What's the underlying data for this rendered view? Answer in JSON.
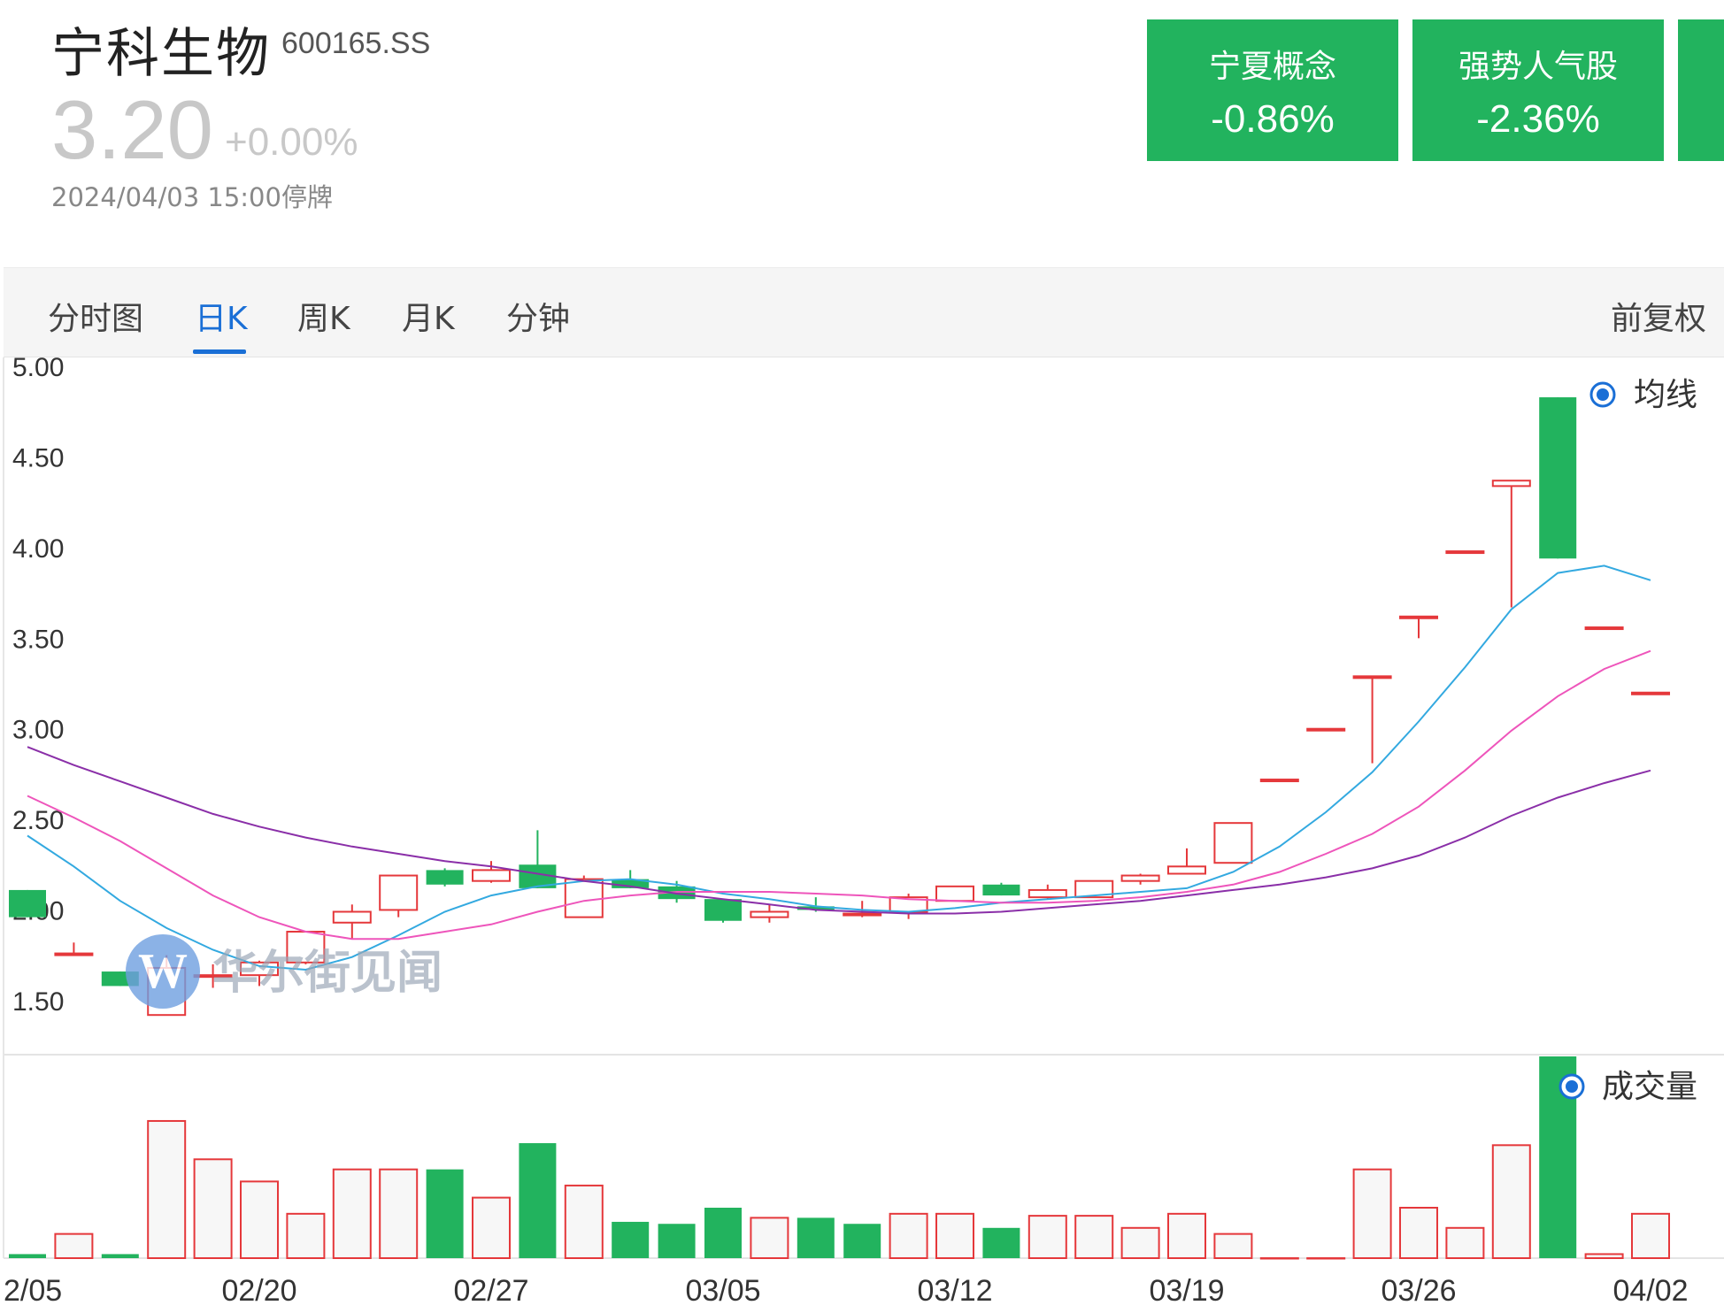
{
  "header": {
    "name": "宁科生物",
    "code": "600165.SS",
    "price": "3.20",
    "change": "+0.00%",
    "status": "2024/04/03 15:00停牌"
  },
  "tags": [
    {
      "name": "宁夏概念",
      "change": "-0.86%"
    },
    {
      "name": "强势人气股",
      "change": "-2.36%"
    }
  ],
  "tabs": [
    "分时图",
    "日K",
    "周K",
    "月K",
    "分钟"
  ],
  "active_tab": "日K",
  "adjust_label": "前复权",
  "watermark": "华尔街见闻",
  "colors": {
    "up": "#e5383b",
    "down": "#22b35e",
    "accent": "#1a6fd6",
    "ma5": "#33a9e0",
    "ma10": "#ee55bb",
    "ma20": "#8a2fa8"
  },
  "chart_data": [
    {
      "type": "candlestick",
      "title": "",
      "legend": "均线",
      "yticks": [
        "5.00",
        "4.50",
        "4.00",
        "3.50",
        "3.00",
        "2.50",
        "2.00",
        "1.50"
      ],
      "ylim": [
        1.25,
        5.05
      ],
      "xticks": [
        {
          "label": "2/05",
          "index": 0
        },
        {
          "label": "02/20",
          "index": 5
        },
        {
          "label": "02/27",
          "index": 10
        },
        {
          "label": "03/05",
          "index": 15
        },
        {
          "label": "03/12",
          "index": 20
        },
        {
          "label": "03/19",
          "index": 25
        },
        {
          "label": "03/26",
          "index": 30
        },
        {
          "label": "04/02",
          "index": 35
        }
      ],
      "candles": [
        {
          "o": 2.11,
          "c": 1.96,
          "h": 2.11,
          "l": 1.96
        },
        {
          "o": 1.76,
          "c": 1.76,
          "h": 1.82,
          "l": 1.76
        },
        {
          "o": 1.66,
          "c": 1.58,
          "h": 1.66,
          "l": 1.58
        },
        {
          "o": 1.42,
          "c": 1.68,
          "h": 1.75,
          "l": 1.42
        },
        {
          "o": 1.64,
          "c": 1.64,
          "h": 1.7,
          "l": 1.57
        },
        {
          "o": 1.64,
          "c": 1.71,
          "h": 1.72,
          "l": 1.58
        },
        {
          "o": 1.71,
          "c": 1.88,
          "h": 1.88,
          "l": 1.7
        },
        {
          "o": 1.93,
          "c": 1.99,
          "h": 2.03,
          "l": 1.84
        },
        {
          "o": 2.0,
          "c": 2.19,
          "h": 2.19,
          "l": 1.96
        },
        {
          "o": 2.22,
          "c": 2.14,
          "h": 2.23,
          "l": 2.13
        },
        {
          "o": 2.16,
          "c": 2.22,
          "h": 2.27,
          "l": 2.15
        },
        {
          "o": 2.25,
          "c": 2.12,
          "h": 2.44,
          "l": 2.12
        },
        {
          "o": 1.96,
          "c": 2.17,
          "h": 2.19,
          "l": 1.96
        },
        {
          "o": 2.17,
          "c": 2.12,
          "h": 2.22,
          "l": 2.12
        },
        {
          "o": 2.13,
          "c": 2.06,
          "h": 2.16,
          "l": 2.04
        },
        {
          "o": 2.06,
          "c": 1.94,
          "h": 2.06,
          "l": 1.93
        },
        {
          "o": 1.96,
          "c": 1.99,
          "h": 2.03,
          "l": 1.93
        },
        {
          "o": 2.02,
          "c": 2.0,
          "h": 2.07,
          "l": 1.99
        },
        {
          "o": 1.98,
          "c": 1.98,
          "h": 2.05,
          "l": 1.96
        },
        {
          "o": 1.99,
          "c": 2.07,
          "h": 2.09,
          "l": 1.95
        },
        {
          "o": 2.05,
          "c": 2.13,
          "h": 2.13,
          "l": 2.05
        },
        {
          "o": 2.14,
          "c": 2.08,
          "h": 2.15,
          "l": 2.08
        },
        {
          "o": 2.07,
          "c": 2.11,
          "h": 2.14,
          "l": 2.06
        },
        {
          "o": 2.07,
          "c": 2.16,
          "h": 2.16,
          "l": 2.07
        },
        {
          "o": 2.16,
          "c": 2.19,
          "h": 2.2,
          "l": 2.14
        },
        {
          "o": 2.2,
          "c": 2.24,
          "h": 2.34,
          "l": 2.2
        },
        {
          "o": 2.26,
          "c": 2.48,
          "h": 2.48,
          "l": 2.26
        },
        {
          "o": 2.72,
          "c": 2.72,
          "h": 2.72,
          "l": 2.72
        },
        {
          "o": 3.0,
          "c": 3.0,
          "h": 3.0,
          "l": 3.0
        },
        {
          "o": 3.29,
          "c": 3.29,
          "h": 3.29,
          "l": 2.81
        },
        {
          "o": 3.62,
          "c": 3.62,
          "h": 3.62,
          "l": 3.5
        },
        {
          "o": 3.98,
          "c": 3.98,
          "h": 3.98,
          "l": 3.98
        },
        {
          "o": 4.34,
          "c": 4.37,
          "h": 4.37,
          "l": 3.67
        },
        {
          "o": 4.83,
          "c": 3.94,
          "h": 4.83,
          "l": 3.94
        },
        {
          "o": 3.56,
          "c": 3.56,
          "h": 3.56,
          "l": 3.56
        },
        {
          "o": 3.2,
          "c": 3.2,
          "h": 3.2,
          "l": 3.2
        }
      ],
      "ma_series": [
        {
          "values": [
            2.41,
            2.24,
            2.05,
            1.9,
            1.78,
            1.69,
            1.67,
            1.74,
            1.86,
            1.99,
            2.08,
            2.13,
            2.16,
            2.17,
            2.14,
            2.09,
            2.06,
            2.02,
            2.0,
            1.99,
            2.01,
            2.04,
            2.06,
            2.08,
            2.1,
            2.12,
            2.21,
            2.35,
            2.54,
            2.76,
            3.04,
            3.34,
            3.66,
            3.86,
            3.9,
            3.82
          ]
        },
        {
          "values": [
            2.63,
            2.51,
            2.38,
            2.23,
            2.08,
            1.96,
            1.88,
            1.84,
            1.84,
            1.88,
            1.92,
            1.99,
            2.05,
            2.08,
            2.1,
            2.1,
            2.1,
            2.09,
            2.08,
            2.06,
            2.05,
            2.04,
            2.04,
            2.05,
            2.07,
            2.1,
            2.14,
            2.21,
            2.31,
            2.42,
            2.57,
            2.77,
            2.99,
            3.18,
            3.33,
            3.43
          ]
        },
        {
          "values": [
            2.9,
            2.8,
            2.71,
            2.62,
            2.53,
            2.46,
            2.4,
            2.35,
            2.31,
            2.27,
            2.24,
            2.2,
            2.16,
            2.13,
            2.09,
            2.06,
            2.03,
            2.0,
            1.99,
            1.98,
            1.98,
            1.99,
            2.01,
            2.03,
            2.05,
            2.08,
            2.11,
            2.14,
            2.18,
            2.23,
            2.3,
            2.4,
            2.52,
            2.62,
            2.7,
            2.77
          ]
        }
      ]
    },
    {
      "type": "bar",
      "title": "",
      "legend": "成交量",
      "volume": [
        {
          "v": 2,
          "up": false
        },
        {
          "v": 12,
          "up": true
        },
        {
          "v": 2,
          "up": false
        },
        {
          "v": 68,
          "up": true
        },
        {
          "v": 49,
          "up": true
        },
        {
          "v": 38,
          "up": true
        },
        {
          "v": 22,
          "up": true
        },
        {
          "v": 44,
          "up": true
        },
        {
          "v": 44,
          "up": true
        },
        {
          "v": 44,
          "up": false
        },
        {
          "v": 30,
          "up": true
        },
        {
          "v": 57,
          "up": false
        },
        {
          "v": 36,
          "up": true
        },
        {
          "v": 18,
          "up": false
        },
        {
          "v": 17,
          "up": false
        },
        {
          "v": 25,
          "up": false
        },
        {
          "v": 20,
          "up": true
        },
        {
          "v": 20,
          "up": false
        },
        {
          "v": 17,
          "up": false
        },
        {
          "v": 22,
          "up": true
        },
        {
          "v": 22,
          "up": true
        },
        {
          "v": 15,
          "up": false
        },
        {
          "v": 21,
          "up": true
        },
        {
          "v": 21,
          "up": true
        },
        {
          "v": 15,
          "up": true
        },
        {
          "v": 22,
          "up": true
        },
        {
          "v": 12,
          "up": true
        },
        {
          "v": 0,
          "up": true
        },
        {
          "v": 0,
          "up": true
        },
        {
          "v": 44,
          "up": true
        },
        {
          "v": 25,
          "up": true
        },
        {
          "v": 15,
          "up": true
        },
        {
          "v": 56,
          "up": true
        },
        {
          "v": 100,
          "up": false
        },
        {
          "v": 2,
          "up": true
        },
        {
          "v": 22,
          "up": true
        }
      ]
    }
  ]
}
